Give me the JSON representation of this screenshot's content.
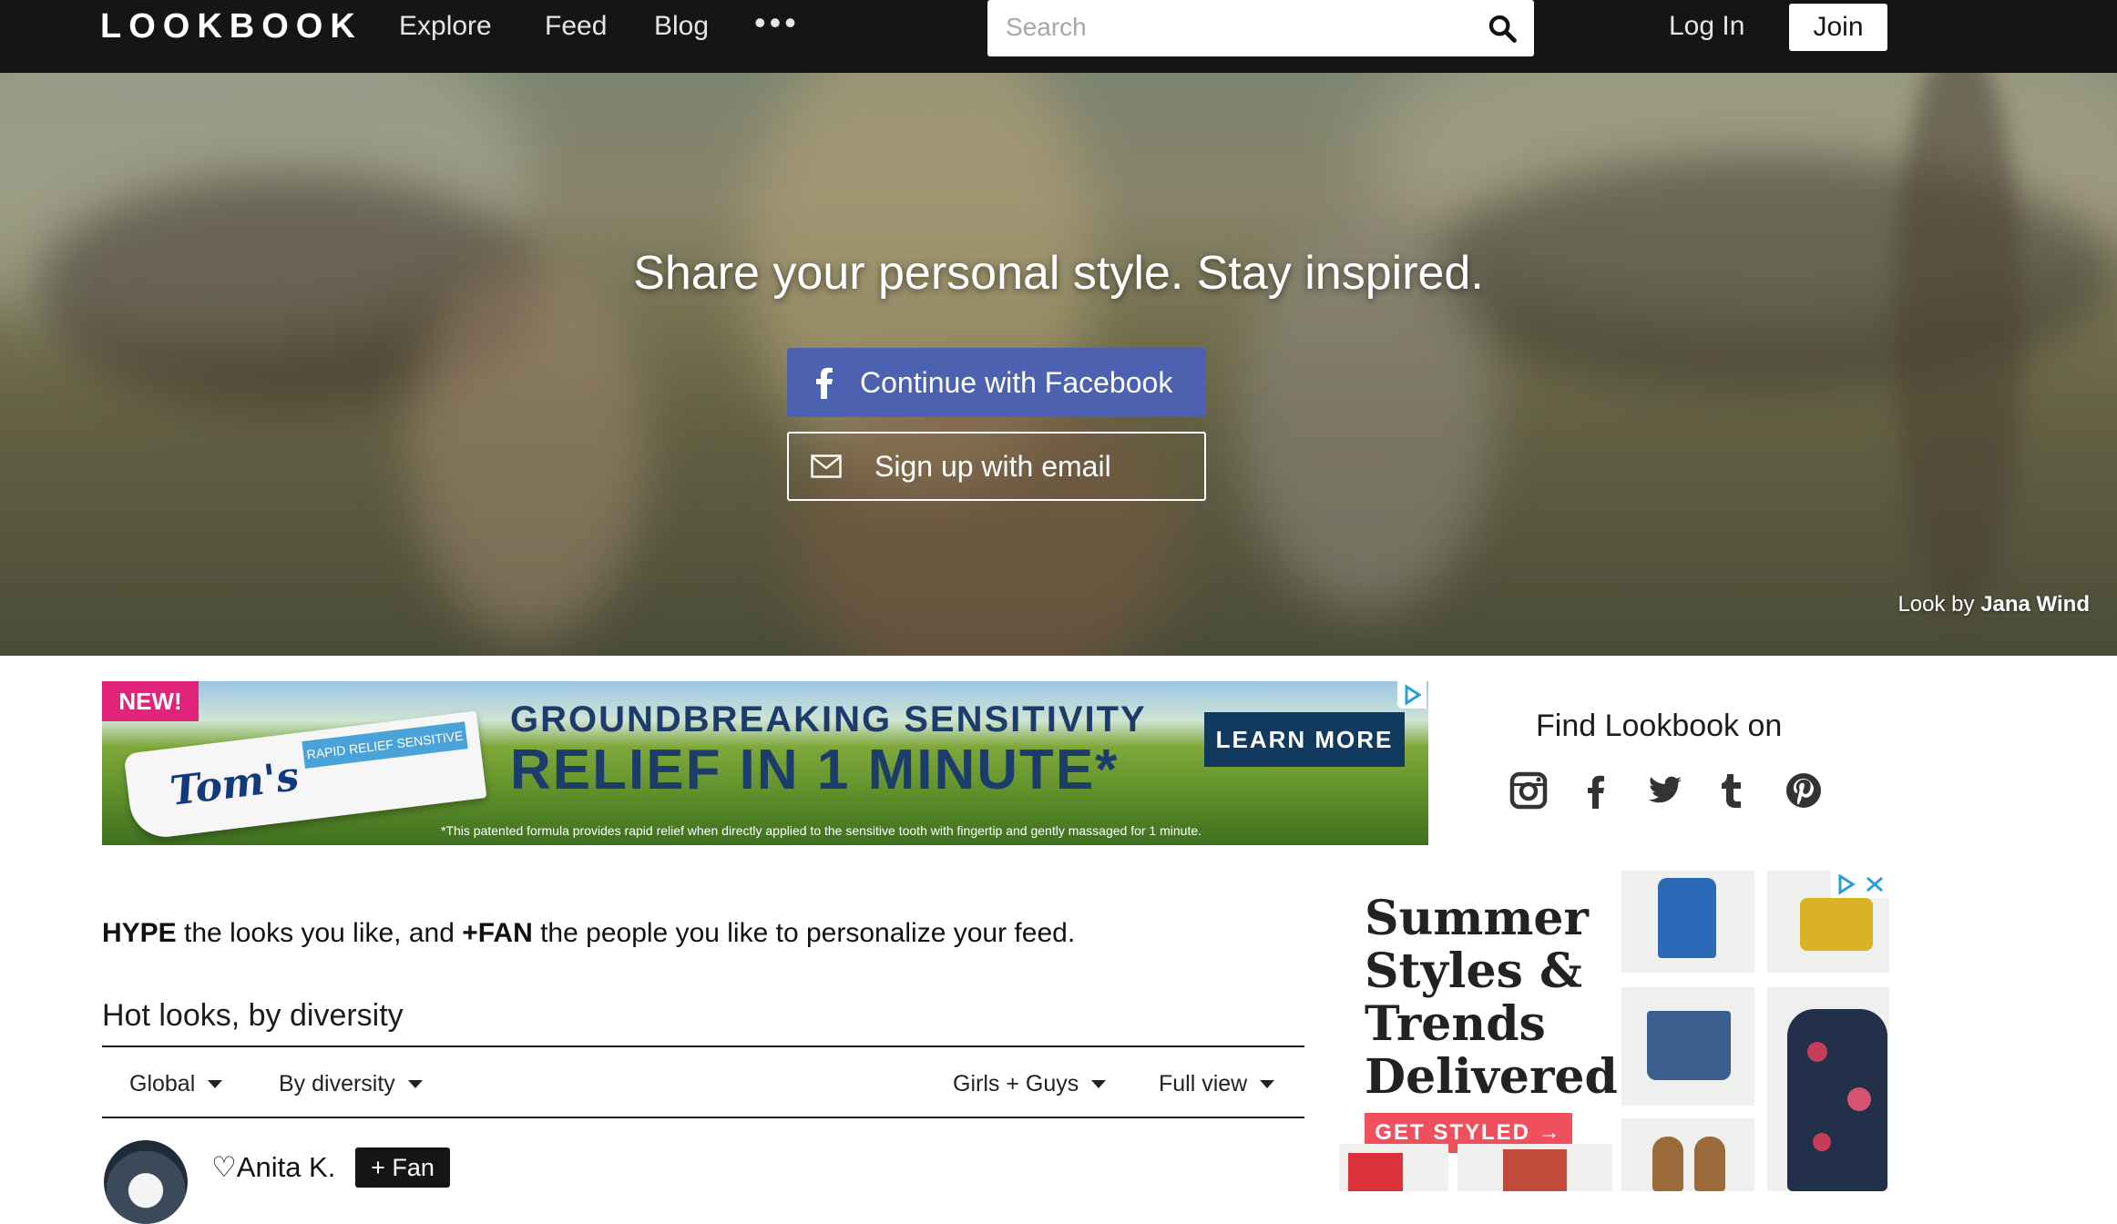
{
  "nav": {
    "logo": "LOOKBOOK",
    "links": [
      "Explore",
      "Feed",
      "Blog"
    ],
    "more": "•••",
    "search_placeholder": "Search",
    "login": "Log In",
    "join": "Join"
  },
  "hero": {
    "title": "Share your personal style. Stay inspired.",
    "facebook_button": "Continue with Facebook",
    "email_button": "Sign up with email",
    "credit_prefix": "Look by",
    "credit_name": "Jana Wind"
  },
  "ad_banner": {
    "badge": "NEW!",
    "brand": "Tom's",
    "tube_label": "RAPID RELIEF SENSITIVE",
    "headline_1": "GROUNDBREAKING SENSITIVITY",
    "headline_2": "RELIEF IN 1 MINUTE*",
    "cta": "LEARN MORE",
    "fine_print": "*This patented formula provides rapid relief when directly applied to the sensitive tooth with fingertip and gently massaged for 1 minute."
  },
  "sidebar": {
    "find_title": "Find Lookbook on",
    "social_icons": [
      "instagram-icon",
      "facebook-icon",
      "twitter-icon",
      "tumblr-icon",
      "pinterest-icon"
    ],
    "ad": {
      "title": "Summer Styles & Trends Delivered",
      "cta": "GET STYLED →"
    }
  },
  "feed": {
    "hype_bold_1": "HYPE",
    "hype_text_1": " the looks you like, and ",
    "hype_bold_2": "+FAN",
    "hype_text_2": " the people you like to personalize your feed.",
    "section_title": "Hot looks, by diversity",
    "filters": {
      "region": "Global",
      "sort": "By diversity",
      "gender": "Girls + Guys",
      "view": "Full view"
    },
    "first_user": {
      "name": "♡Anita K.",
      "fan_button": "+ Fan"
    }
  },
  "colors": {
    "nav_bg": "#151515",
    "facebook_blue": "#4c62b0",
    "badge_pink": "#e2237a",
    "cta_coral": "#f0505e"
  }
}
